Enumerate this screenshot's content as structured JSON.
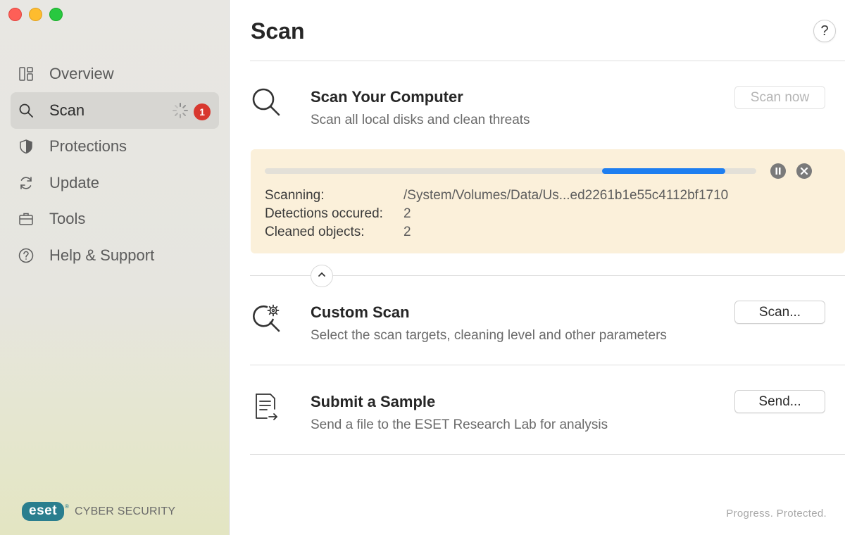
{
  "window": {
    "controls": [
      "close",
      "minimize",
      "zoom"
    ]
  },
  "sidebar": {
    "items": [
      {
        "label": "Overview",
        "icon": "overview-icon"
      },
      {
        "label": "Scan",
        "icon": "search-icon",
        "active": true,
        "badge": "1",
        "spinner": true
      },
      {
        "label": "Protections",
        "icon": "shield-icon"
      },
      {
        "label": "Update",
        "icon": "refresh-icon"
      },
      {
        "label": "Tools",
        "icon": "briefcase-icon"
      },
      {
        "label": "Help & Support",
        "icon": "question-icon"
      }
    ],
    "brand": {
      "logo": "eset",
      "superscript": "®",
      "product": "CYBER SECURITY"
    }
  },
  "main": {
    "title": "Scan",
    "help_label": "?",
    "scan_computer": {
      "title": "Scan Your Computer",
      "description": "Scan all local disks and clean threats",
      "button": "Scan now",
      "button_disabled": true
    },
    "progress": {
      "fraction_start": 0.686,
      "fraction_end": 0.937,
      "rows": [
        {
          "label": "Scanning:",
          "value": "/System/Volumes/Data/Us...ed2261b1e55c4112bf1710"
        },
        {
          "label": "Detections occured:",
          "value": "2"
        },
        {
          "label": "Cleaned objects:",
          "value": "2"
        }
      ],
      "panel_color": "#fbf0da",
      "bar_color": "#1e7ef0"
    },
    "custom_scan": {
      "title": "Custom Scan",
      "description": "Select the scan targets, cleaning level and other parameters",
      "button": "Scan..."
    },
    "submit_sample": {
      "title": "Submit a Sample",
      "description": "Send a file to the ESET Research Lab for analysis",
      "button": "Send..."
    },
    "footer_tagline": "Progress. Protected."
  },
  "colors": {
    "badge": "#d8382f",
    "brand": "#2a7e8e"
  }
}
